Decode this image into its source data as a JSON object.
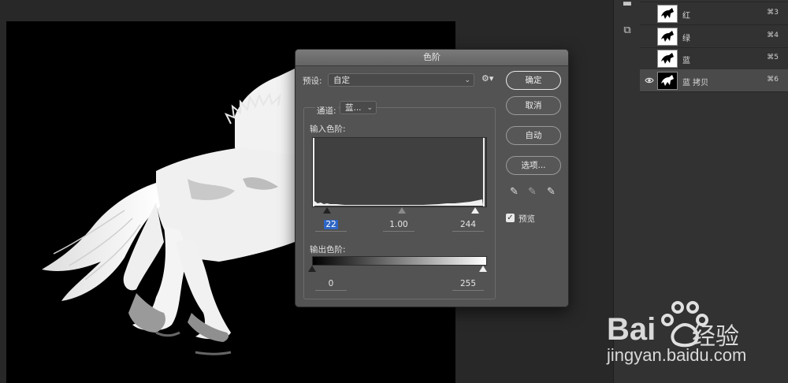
{
  "dialog": {
    "title": "色阶",
    "preset_label": "预设:",
    "preset_value": "自定",
    "channel_label": "通道:",
    "channel_value": "蓝...",
    "input_levels_label": "输入色阶:",
    "output_levels_label": "输出色阶:",
    "input_black": "22",
    "input_gamma": "1.00",
    "input_white": "244",
    "output_black": "0",
    "output_white": "255",
    "buttons": {
      "ok": "确定",
      "cancel": "取消",
      "auto": "自动",
      "options": "选项..."
    },
    "preview_label": "预览",
    "preview_checked": true
  },
  "layers": [
    {
      "name": "红",
      "shortcut": "⌘3",
      "visible": false,
      "active": false
    },
    {
      "name": "绿",
      "shortcut": "⌘4",
      "visible": false,
      "active": false
    },
    {
      "name": "蓝",
      "shortcut": "⌘5",
      "visible": false,
      "active": false
    },
    {
      "name": "蓝 拷贝",
      "shortcut": "⌘6",
      "visible": true,
      "active": true
    }
  ],
  "watermark": {
    "brand": "Bai",
    "brand_tail": "经验",
    "url": "jingyan.baidu.com"
  },
  "colors": {
    "panel_bg": "#323232",
    "dialog_bg": "#535353",
    "selection": "#2f66c6"
  }
}
